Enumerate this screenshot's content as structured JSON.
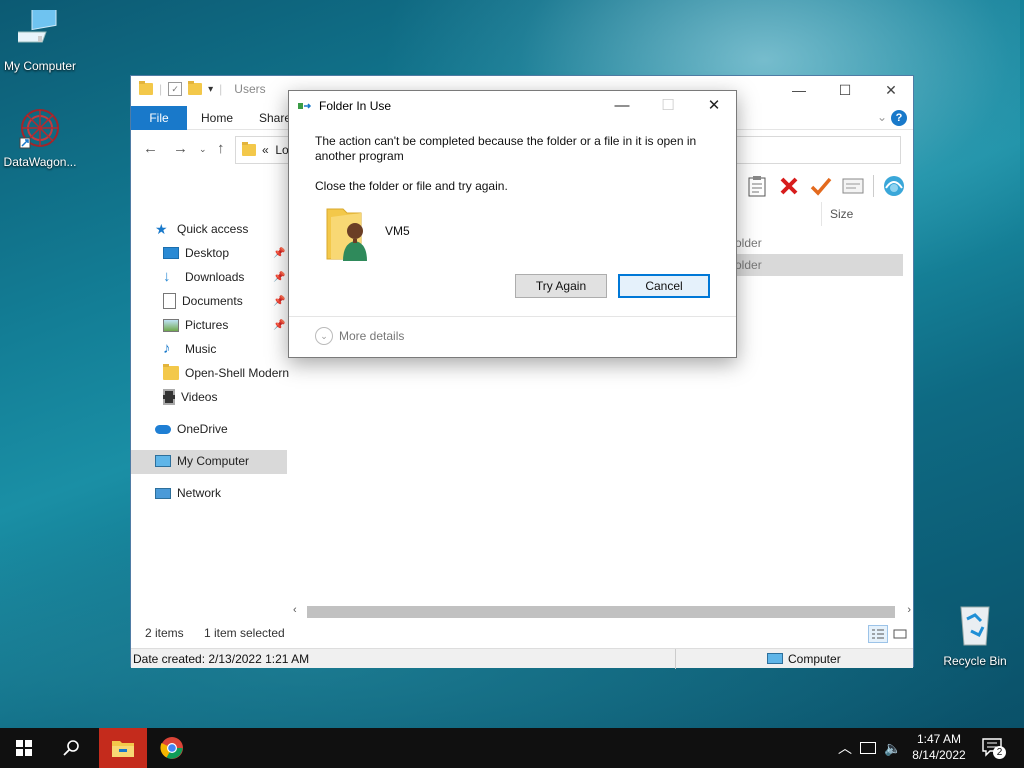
{
  "desktop": {
    "icons": [
      {
        "label": "My Computer"
      },
      {
        "label": "DataWagon..."
      },
      {
        "label": "Recycle Bin"
      }
    ]
  },
  "explorer": {
    "title": "Users",
    "ribbon_tabs": [
      "File",
      "Home",
      "Share"
    ],
    "address_text": "Lo",
    "column_header": "Size",
    "rows": [
      "older",
      "older"
    ],
    "nav": {
      "quick_access": "Quick access",
      "items": [
        {
          "label": "Desktop",
          "pinned": true
        },
        {
          "label": "Downloads",
          "pinned": true
        },
        {
          "label": "Documents",
          "pinned": true
        },
        {
          "label": "Pictures",
          "pinned": true
        },
        {
          "label": "Music",
          "pinned": false
        },
        {
          "label": "Open-Shell Modern",
          "pinned": false
        },
        {
          "label": "Videos",
          "pinned": false
        }
      ],
      "onedrive": "OneDrive",
      "my_computer": "My Computer",
      "network": "Network"
    },
    "status": {
      "items_count": "2 items",
      "selected": "1 item selected",
      "date_created": "Date created: 2/13/2022 1:21 AM",
      "location": "Computer"
    }
  },
  "dialog": {
    "title": "Folder In Use",
    "message_line1": "The action can't be completed because the folder or a file in it is open in",
    "message_line2": "another program",
    "instruction": "Close the folder or file and try again.",
    "file_name": "VM5",
    "try_again": "Try Again",
    "cancel": "Cancel",
    "more_details": "More details"
  },
  "taskbar": {
    "time": "1:47 AM",
    "date": "8/14/2022",
    "notifications": "2"
  },
  "colors": {
    "accent": "#1979ca",
    "taskbar": "#101010",
    "active_task": "#c42b1c"
  }
}
